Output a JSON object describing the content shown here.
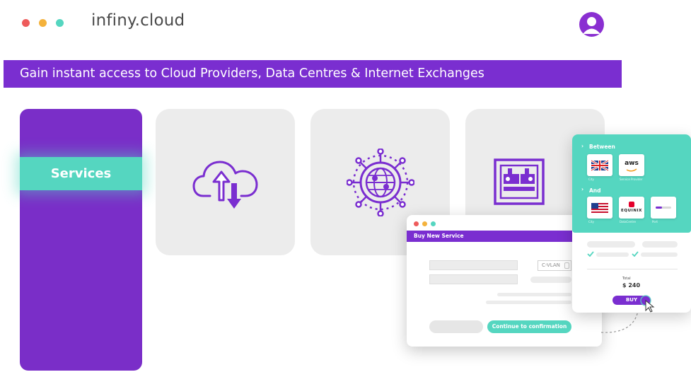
{
  "header": {
    "brand": "infiny.cloud",
    "dots": [
      "#ee5b5b",
      "#f4b23c",
      "#55d6c0"
    ]
  },
  "banner": {
    "text": "Gain instant access to Cloud Providers, Data Centres & Internet Exchanges"
  },
  "sidebar": {
    "active_item": "Services"
  },
  "tiles": [
    {
      "icon": "cloud-upload-download-icon"
    },
    {
      "icon": "globe-network-icon"
    },
    {
      "icon": "data-centre-rack-icon"
    }
  ],
  "buy_window": {
    "title": "Buy New Service",
    "cvlan_label": "C-VLAN",
    "confirm_label": "Continue to confirmation"
  },
  "summary": {
    "between_label": "Between",
    "and_label": "And",
    "from_provider": "aws",
    "to_provider": "EQUINIX",
    "cap_city_1": "City",
    "cap_provider": "Service Provider",
    "cap_city_2": "City",
    "cap_datacentre": "DataCentre",
    "cap_port": "Port",
    "total_label": "Total",
    "total_value": "$ 240",
    "buy_label": "BUY"
  },
  "colors": {
    "purple": "#7a2ed0",
    "teal": "#55d6c0",
    "tile": "#ececec"
  }
}
